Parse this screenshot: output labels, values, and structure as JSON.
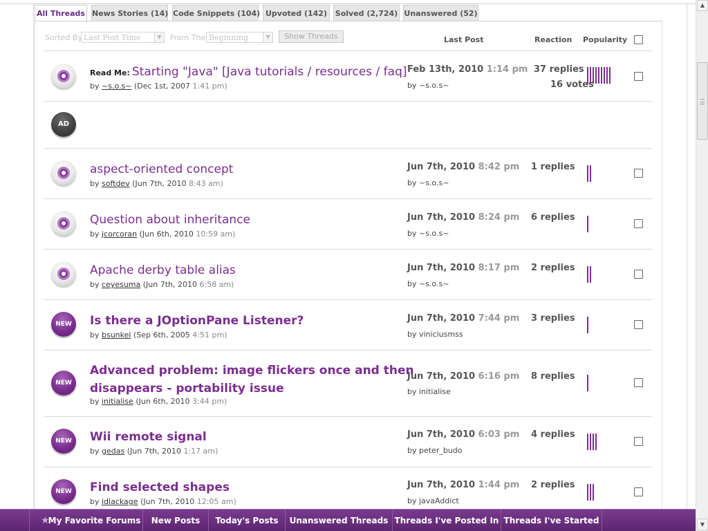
{
  "tabs": [
    {
      "label": "All Threads",
      "active": true
    },
    {
      "label": "News Stories (14)",
      "active": false
    },
    {
      "label": "Code Snippets (104)",
      "active": false
    },
    {
      "label": "Upvoted (142)",
      "active": false
    },
    {
      "label": "Solved (2,724)",
      "active": false
    },
    {
      "label": "Unanswered (52)",
      "active": false
    }
  ],
  "filters": {
    "sorted_by_label": "Sorted By",
    "sorted_by_value": "Last Post Time",
    "from_label": "From The",
    "from_value": "Beginning",
    "show_threads_label": "Show Threads"
  },
  "columns": {
    "last_post": "Last Post",
    "reaction": "Reaction",
    "popularity": "Popularity"
  },
  "ad": {
    "label": "AD"
  },
  "threads": [
    {
      "icon": "read",
      "prefix": "Read Me:",
      "title": "Starting \"Java\" [Java tutorials / resources / faq]",
      "author": "~s.o.s~",
      "started_date": "(Dec 1st, 2007",
      "started_time": "1:41 pm)",
      "last_date": "Feb 13th, 2010",
      "last_time": "1:14 pm",
      "last_by": "by ~s.o.s~",
      "replies": "37 replies",
      "votes": "16 votes",
      "popularity": 9
    },
    {
      "icon": "read",
      "prefix": "",
      "title": "aspect-oriented concept",
      "author": "softdev",
      "started_date": "(Jun 7th, 2010",
      "started_time": "8:43 am)",
      "last_date": "Jun 7th, 2010",
      "last_time": "8:42 pm",
      "last_by": "by ~s.o.s~",
      "replies": "1 replies",
      "votes": "",
      "popularity": 2
    },
    {
      "icon": "read",
      "prefix": "",
      "title": "Question about inheritance",
      "author": "jcorcoran",
      "started_date": "(Jun 6th, 2010",
      "started_time": "10:59 am)",
      "last_date": "Jun 7th, 2010",
      "last_time": "8:24 pm",
      "last_by": "by ~s.o.s~",
      "replies": "6 replies",
      "votes": "",
      "popularity": 1
    },
    {
      "icon": "read",
      "prefix": "",
      "title": "Apache derby table alias",
      "author": "ceyesuma",
      "started_date": "(Jun 7th, 2010",
      "started_time": "6:58 am)",
      "last_date": "Jun 7th, 2010",
      "last_time": "8:17 pm",
      "last_by": "by ~s.o.s~",
      "replies": "2 replies",
      "votes": "",
      "popularity": 2
    },
    {
      "icon": "new",
      "prefix": "",
      "title": "Is there a JOptionPane Listener?",
      "author": "bsunkel",
      "started_date": "(Sep 6th, 2005",
      "started_time": "4:51 pm)",
      "last_date": "Jun 7th, 2010",
      "last_time": "7:44 pm",
      "last_by": "by viniciusmss",
      "replies": "3 replies",
      "votes": "",
      "popularity": 1
    },
    {
      "icon": "new",
      "prefix": "",
      "title": "Advanced problem: image flickers once and then",
      "title2": "disappears - portability issue",
      "author": "initialise",
      "started_date": "(Jun 6th, 2010",
      "started_time": "3:44 pm)",
      "last_date": "Jun 7th, 2010",
      "last_time": "6:16 pm",
      "last_by": "by initialise",
      "replies": "8 replies",
      "votes": "",
      "popularity": 1
    },
    {
      "icon": "new",
      "prefix": "",
      "title": "Wii remote signal",
      "author": "gedas",
      "started_date": "(Jun 7th, 2010",
      "started_time": "1:17 am)",
      "last_date": "Jun 7th, 2010",
      "last_time": "6:03 pm",
      "last_by": "by peter_budo",
      "replies": "4 replies",
      "votes": "",
      "popularity": 4
    },
    {
      "icon": "new",
      "prefix": "",
      "title": "Find selected shapes",
      "author": "idlackage",
      "started_date": "(Jun 7th, 2010",
      "started_time": "12:05 am)",
      "last_date": "Jun 7th, 2010",
      "last_time": "1:44 pm",
      "last_by": "by javaAddict",
      "replies": "2 replies",
      "votes": "",
      "popularity": 3
    }
  ],
  "icon_labels": {
    "new": "NEW"
  },
  "by_label": "by",
  "bottom_bar": [
    {
      "label": "My Favorite Forums",
      "icon": "star-icon"
    },
    {
      "label": "New Posts"
    },
    {
      "label": "Today's Posts"
    },
    {
      "label": "Unanswered Threads"
    },
    {
      "label": "Threads I've Posted In"
    },
    {
      "label": "Threads I've Started"
    }
  ],
  "colors": {
    "accent": "#7a2e8e",
    "bar": "#6a2e80"
  }
}
